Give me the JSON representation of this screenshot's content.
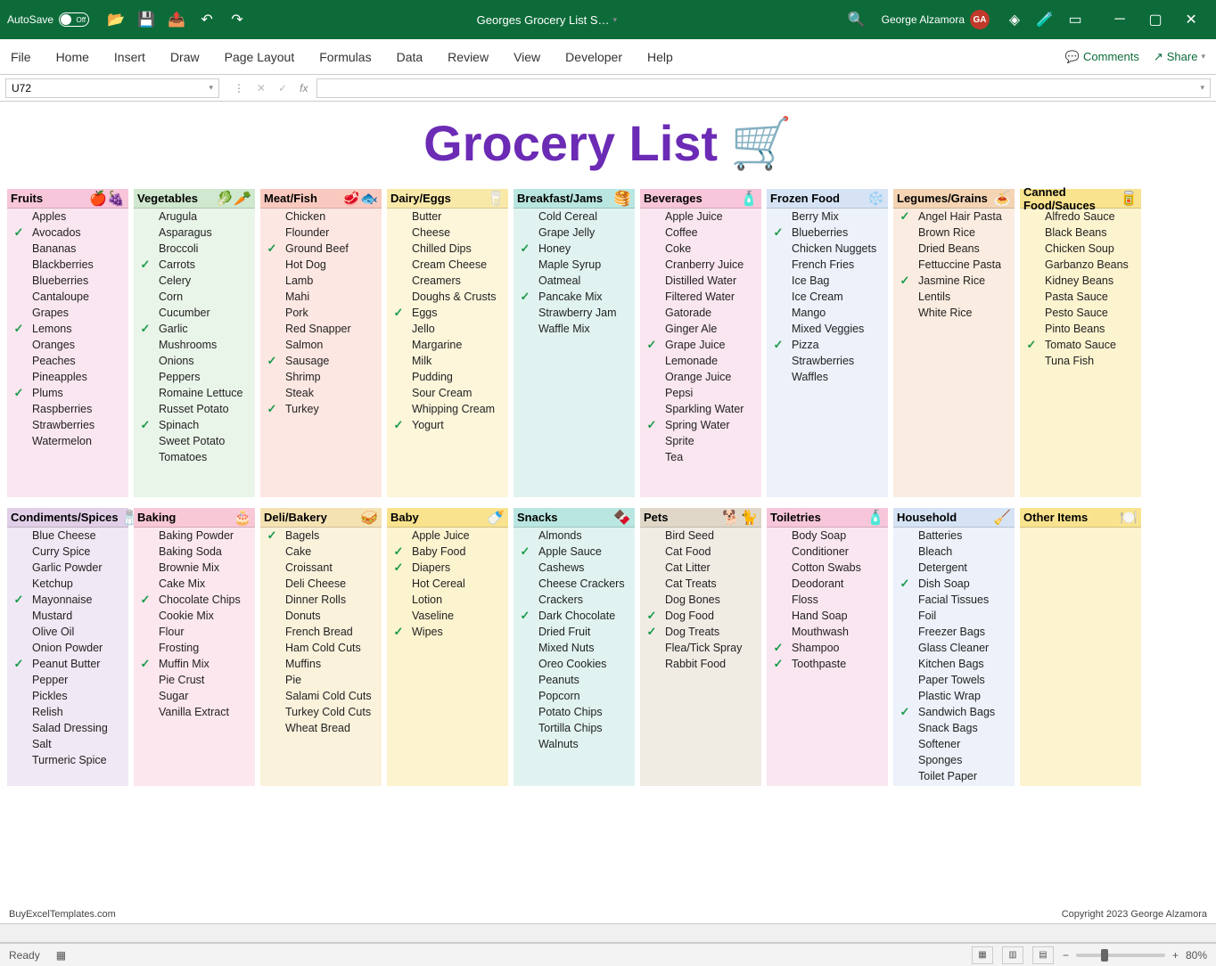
{
  "titlebar": {
    "autosave": "AutoSave",
    "autosave_state": "Off",
    "doc_title": "Georges Grocery List S…",
    "user_name": "George Alzamora",
    "user_initials": "GA"
  },
  "ribbon": {
    "tabs": [
      "File",
      "Home",
      "Insert",
      "Draw",
      "Page Layout",
      "Formulas",
      "Data",
      "Review",
      "View",
      "Developer",
      "Help"
    ],
    "comments": "Comments",
    "share": "Share"
  },
  "formula": {
    "cell": "U72",
    "fx": "fx"
  },
  "page": {
    "title": "Grocery List",
    "title_icon": "🛒",
    "footer_left": "BuyExcelTemplates.com",
    "footer_right": "Copyright 2023 George Alzamora"
  },
  "status": {
    "ready": "Ready",
    "zoom": "80%"
  },
  "categories_row1": [
    {
      "name": "Fruits",
      "icon": "🍎🍇",
      "head_bg": "#f7c6da",
      "body_bg": "#fae6f0",
      "items": [
        [
          "",
          "Apples"
        ],
        [
          "✓",
          "Avocados"
        ],
        [
          "",
          "Bananas"
        ],
        [
          "",
          "Blackberries"
        ],
        [
          "",
          "Blueberries"
        ],
        [
          "",
          "Cantaloupe"
        ],
        [
          "",
          "Grapes"
        ],
        [
          "✓",
          "Lemons"
        ],
        [
          "",
          "Oranges"
        ],
        [
          "",
          "Peaches"
        ],
        [
          "",
          "Pineapples"
        ],
        [
          "✓",
          "Plums"
        ],
        [
          "",
          "Raspberries"
        ],
        [
          "",
          "Strawberries"
        ],
        [
          "",
          "Watermelon"
        ],
        [
          "",
          ""
        ],
        [
          "",
          ""
        ],
        [
          "",
          ""
        ]
      ]
    },
    {
      "name": "Vegetables",
      "icon": "🥬🥕",
      "head_bg": "#cfe8cf",
      "body_bg": "#eaf5ea",
      "items": [
        [
          "",
          "Arugula"
        ],
        [
          "",
          "Asparagus"
        ],
        [
          "",
          "Broccoli"
        ],
        [
          "✓",
          "Carrots"
        ],
        [
          "",
          "Celery"
        ],
        [
          "",
          "Corn"
        ],
        [
          "",
          "Cucumber"
        ],
        [
          "✓",
          "Garlic"
        ],
        [
          "",
          "Mushrooms"
        ],
        [
          "",
          "Onions"
        ],
        [
          "",
          "Peppers"
        ],
        [
          "",
          "Romaine Lettuce"
        ],
        [
          "",
          "Russet Potato"
        ],
        [
          "✓",
          "Spinach"
        ],
        [
          "",
          "Sweet Potato"
        ],
        [
          "",
          "Tomatoes"
        ],
        [
          "",
          ""
        ],
        [
          "",
          ""
        ]
      ]
    },
    {
      "name": "Meat/Fish",
      "icon": "🥩🐟",
      "head_bg": "#f9c9bf",
      "body_bg": "#fde7e2",
      "items": [
        [
          "",
          "Chicken"
        ],
        [
          "",
          "Flounder"
        ],
        [
          "✓",
          "Ground Beef"
        ],
        [
          "",
          "Hot Dog"
        ],
        [
          "",
          "Lamb"
        ],
        [
          "",
          "Mahi"
        ],
        [
          "",
          "Pork"
        ],
        [
          "",
          "Red Snapper"
        ],
        [
          "",
          "Salmon"
        ],
        [
          "✓",
          "Sausage"
        ],
        [
          "",
          "Shrimp"
        ],
        [
          "",
          "Steak"
        ],
        [
          "✓",
          "Turkey"
        ],
        [
          "",
          ""
        ],
        [
          "",
          ""
        ],
        [
          "",
          ""
        ],
        [
          "",
          ""
        ],
        [
          "",
          ""
        ]
      ]
    },
    {
      "name": "Dairy/Eggs",
      "icon": "🥛",
      "head_bg": "#f9e9a9",
      "body_bg": "#fdf6db",
      "items": [
        [
          "",
          "Butter"
        ],
        [
          "",
          "Cheese"
        ],
        [
          "",
          "Chilled Dips"
        ],
        [
          "",
          "Cream Cheese"
        ],
        [
          "",
          "Creamers"
        ],
        [
          "",
          "Doughs & Crusts"
        ],
        [
          "✓",
          "Eggs"
        ],
        [
          "",
          "Jello"
        ],
        [
          "",
          "Margarine"
        ],
        [
          "",
          "Milk"
        ],
        [
          "",
          "Pudding"
        ],
        [
          "",
          "Sour Cream"
        ],
        [
          "",
          "Whipping Cream"
        ],
        [
          "✓",
          "Yogurt"
        ],
        [
          "",
          ""
        ],
        [
          "",
          ""
        ],
        [
          "",
          ""
        ],
        [
          "",
          ""
        ]
      ]
    },
    {
      "name": "Breakfast/Jams",
      "icon": "🥞",
      "head_bg": "#b9e6e0",
      "body_bg": "#e1f3f1",
      "items": [
        [
          "",
          "Cold Cereal"
        ],
        [
          "",
          "Grape Jelly"
        ],
        [
          "✓",
          "Honey"
        ],
        [
          "",
          "Maple Syrup"
        ],
        [
          "",
          "Oatmeal"
        ],
        [
          "✓",
          "Pancake Mix"
        ],
        [
          "",
          "Strawberry Jam"
        ],
        [
          "",
          "Waffle Mix"
        ],
        [
          "",
          ""
        ],
        [
          "",
          ""
        ],
        [
          "",
          ""
        ],
        [
          "",
          ""
        ],
        [
          "",
          ""
        ],
        [
          "",
          ""
        ],
        [
          "",
          ""
        ],
        [
          "",
          ""
        ],
        [
          "",
          ""
        ],
        [
          "",
          ""
        ]
      ]
    },
    {
      "name": "Beverages",
      "icon": "🧴",
      "head_bg": "#f7c6da",
      "body_bg": "#fae6f0",
      "items": [
        [
          "",
          "Apple Juice"
        ],
        [
          "",
          "Coffee"
        ],
        [
          "",
          "Coke"
        ],
        [
          "",
          "Cranberry Juice"
        ],
        [
          "",
          "Distilled Water"
        ],
        [
          "",
          "Filtered Water"
        ],
        [
          "",
          "Gatorade"
        ],
        [
          "",
          "Ginger Ale"
        ],
        [
          "✓",
          "Grape Juice"
        ],
        [
          "",
          "Lemonade"
        ],
        [
          "",
          "Orange Juice"
        ],
        [
          "",
          "Pepsi"
        ],
        [
          "",
          "Sparkling Water"
        ],
        [
          "✓",
          "Spring Water"
        ],
        [
          "",
          "Sprite"
        ],
        [
          "",
          "Tea"
        ],
        [
          "",
          ""
        ],
        [
          "",
          ""
        ]
      ]
    },
    {
      "name": "Frozen Food",
      "icon": "❄️",
      "head_bg": "#d6e3f5",
      "body_bg": "#ecf1fa",
      "items": [
        [
          "",
          "Berry Mix"
        ],
        [
          "✓",
          "Blueberries"
        ],
        [
          "",
          "Chicken Nuggets"
        ],
        [
          "",
          "French Fries"
        ],
        [
          "",
          "Ice Bag"
        ],
        [
          "",
          "Ice Cream"
        ],
        [
          "",
          "Mango"
        ],
        [
          "",
          "Mixed Veggies"
        ],
        [
          "✓",
          "Pizza"
        ],
        [
          "",
          "Strawberries"
        ],
        [
          "",
          "Waffles"
        ],
        [
          "",
          ""
        ],
        [
          "",
          ""
        ],
        [
          "",
          ""
        ],
        [
          "",
          ""
        ],
        [
          "",
          ""
        ],
        [
          "",
          ""
        ],
        [
          "",
          ""
        ]
      ]
    },
    {
      "name": "Legumes/Grains",
      "icon": "🍝",
      "head_bg": "#f4d4b3",
      "body_bg": "#faece0",
      "items": [
        [
          "✓",
          "Angel Hair Pasta"
        ],
        [
          "",
          "Brown Rice"
        ],
        [
          "",
          "Dried Beans"
        ],
        [
          "",
          "Fettuccine Pasta"
        ],
        [
          "✓",
          "Jasmine Rice"
        ],
        [
          "",
          "Lentils"
        ],
        [
          "",
          "White Rice"
        ],
        [
          "",
          ""
        ],
        [
          "",
          ""
        ],
        [
          "",
          ""
        ],
        [
          "",
          ""
        ],
        [
          "",
          ""
        ],
        [
          "",
          ""
        ],
        [
          "",
          ""
        ],
        [
          "",
          ""
        ],
        [
          "",
          ""
        ],
        [
          "",
          ""
        ],
        [
          "",
          ""
        ]
      ]
    },
    {
      "name": "Canned Food/Sauces",
      "icon": "🥫",
      "head_bg": "#f9e38f",
      "body_bg": "#fcf3cf",
      "items": [
        [
          "",
          "Alfredo Sauce"
        ],
        [
          "",
          "Black Beans"
        ],
        [
          "",
          "Chicken Soup"
        ],
        [
          "",
          "Garbanzo Beans"
        ],
        [
          "",
          "Kidney Beans"
        ],
        [
          "",
          "Pasta Sauce"
        ],
        [
          "",
          "Pesto Sauce"
        ],
        [
          "",
          "Pinto Beans"
        ],
        [
          "✓",
          "Tomato Sauce"
        ],
        [
          "",
          "Tuna Fish"
        ],
        [
          "",
          ""
        ],
        [
          "",
          ""
        ],
        [
          "",
          ""
        ],
        [
          "",
          ""
        ],
        [
          "",
          ""
        ],
        [
          "",
          ""
        ],
        [
          "",
          ""
        ],
        [
          "",
          ""
        ]
      ]
    }
  ],
  "categories_row2": [
    {
      "name": "Condiments/Spices",
      "icon": "🧂",
      "head_bg": "#e1cfe8",
      "body_bg": "#f0e8f4",
      "items": [
        [
          "",
          "Blue Cheese"
        ],
        [
          "",
          "Curry Spice"
        ],
        [
          "",
          "Garlic Powder"
        ],
        [
          "",
          "Ketchup"
        ],
        [
          "✓",
          "Mayonnaise"
        ],
        [
          "",
          "Mustard"
        ],
        [
          "",
          "Olive Oil"
        ],
        [
          "",
          "Onion Powder"
        ],
        [
          "✓",
          "Peanut Butter"
        ],
        [
          "",
          "Pepper"
        ],
        [
          "",
          "Pickles"
        ],
        [
          "",
          "Relish"
        ],
        [
          "",
          "Salad Dressing"
        ],
        [
          "",
          "Salt"
        ],
        [
          "",
          "Turmeric Spice"
        ],
        [
          "",
          ""
        ]
      ]
    },
    {
      "name": "Baking",
      "icon": "🎂",
      "head_bg": "#f9c8d6",
      "body_bg": "#fce7ee",
      "items": [
        [
          "",
          "Baking Powder"
        ],
        [
          "",
          "Baking Soda"
        ],
        [
          "",
          "Brownie Mix"
        ],
        [
          "",
          "Cake Mix"
        ],
        [
          "✓",
          "Chocolate Chips"
        ],
        [
          "",
          "Cookie Mix"
        ],
        [
          "",
          "Flour"
        ],
        [
          "",
          "Frosting"
        ],
        [
          "✓",
          "Muffin Mix"
        ],
        [
          "",
          "Pie Crust"
        ],
        [
          "",
          "Sugar"
        ],
        [
          "",
          "Vanilla Extract"
        ],
        [
          "",
          ""
        ],
        [
          "",
          ""
        ],
        [
          "",
          ""
        ],
        [
          "",
          ""
        ]
      ]
    },
    {
      "name": "Deli/Bakery",
      "icon": "🥪",
      "head_bg": "#f5e2b3",
      "body_bg": "#fbf2dc",
      "items": [
        [
          "✓",
          "Bagels"
        ],
        [
          "",
          "Cake"
        ],
        [
          "",
          "Croissant"
        ],
        [
          "",
          "Deli Cheese"
        ],
        [
          "",
          "Dinner Rolls"
        ],
        [
          "",
          "Donuts"
        ],
        [
          "",
          "French Bread"
        ],
        [
          "",
          "Ham Cold Cuts"
        ],
        [
          "",
          "Muffins"
        ],
        [
          "",
          "Pie"
        ],
        [
          "",
          "Salami Cold Cuts"
        ],
        [
          "",
          "Turkey Cold Cuts"
        ],
        [
          "",
          "Wheat Bread"
        ],
        [
          "",
          ""
        ],
        [
          "",
          ""
        ],
        [
          "",
          ""
        ]
      ]
    },
    {
      "name": "Baby",
      "icon": "🍼",
      "head_bg": "#f9e38f",
      "body_bg": "#fcf3cf",
      "items": [
        [
          "",
          "Apple Juice"
        ],
        [
          "✓",
          "Baby Food"
        ],
        [
          "✓",
          "Diapers"
        ],
        [
          "",
          "Hot Cereal"
        ],
        [
          "",
          "Lotion"
        ],
        [
          "",
          "Vaseline"
        ],
        [
          "✓",
          "Wipes"
        ],
        [
          "",
          ""
        ],
        [
          "",
          ""
        ],
        [
          "",
          ""
        ],
        [
          "",
          ""
        ],
        [
          "",
          ""
        ],
        [
          "",
          ""
        ],
        [
          "",
          ""
        ],
        [
          "",
          ""
        ],
        [
          "",
          ""
        ]
      ]
    },
    {
      "name": "Snacks",
      "icon": "🍫",
      "head_bg": "#b9e6e0",
      "body_bg": "#e1f3f1",
      "items": [
        [
          "",
          "Almonds"
        ],
        [
          "✓",
          "Apple Sauce"
        ],
        [
          "",
          "Cashews"
        ],
        [
          "",
          "Cheese Crackers"
        ],
        [
          "",
          "Crackers"
        ],
        [
          "✓",
          "Dark Chocolate"
        ],
        [
          "",
          "Dried Fruit"
        ],
        [
          "",
          "Mixed Nuts"
        ],
        [
          "",
          "Oreo Cookies"
        ],
        [
          "",
          "Peanuts"
        ],
        [
          "",
          "Popcorn"
        ],
        [
          "",
          "Potato Chips"
        ],
        [
          "",
          "Tortilla Chips"
        ],
        [
          "",
          "Walnuts"
        ],
        [
          "",
          ""
        ],
        [
          "",
          ""
        ]
      ]
    },
    {
      "name": "Pets",
      "icon": "🐕🐈",
      "head_bg": "#e0d7c8",
      "body_bg": "#f0ece4",
      "items": [
        [
          "",
          "Bird Seed"
        ],
        [
          "",
          "Cat Food"
        ],
        [
          "",
          "Cat Litter"
        ],
        [
          "",
          "Cat Treats"
        ],
        [
          "",
          "Dog Bones"
        ],
        [
          "✓",
          "Dog Food"
        ],
        [
          "✓",
          "Dog Treats"
        ],
        [
          "",
          "Flea/Tick Spray"
        ],
        [
          "",
          "Rabbit Food"
        ],
        [
          "",
          ""
        ],
        [
          "",
          ""
        ],
        [
          "",
          ""
        ],
        [
          "",
          ""
        ],
        [
          "",
          ""
        ],
        [
          "",
          ""
        ],
        [
          "",
          ""
        ]
      ]
    },
    {
      "name": "Toiletries",
      "icon": "🧴",
      "head_bg": "#f7c6da",
      "body_bg": "#fae6f0",
      "items": [
        [
          "",
          "Body Soap"
        ],
        [
          "",
          "Conditioner"
        ],
        [
          "",
          "Cotton Swabs"
        ],
        [
          "",
          "Deodorant"
        ],
        [
          "",
          "Floss"
        ],
        [
          "",
          "Hand Soap"
        ],
        [
          "",
          "Mouthwash"
        ],
        [
          "✓",
          "Shampoo"
        ],
        [
          "✓",
          "Toothpaste"
        ],
        [
          "",
          ""
        ],
        [
          "",
          ""
        ],
        [
          "",
          ""
        ],
        [
          "",
          ""
        ],
        [
          "",
          ""
        ],
        [
          "",
          ""
        ],
        [
          "",
          ""
        ]
      ]
    },
    {
      "name": "Household",
      "icon": "🧹",
      "head_bg": "#d6e3f5",
      "body_bg": "#ecf1fa",
      "items": [
        [
          "",
          "Batteries"
        ],
        [
          "",
          "Bleach"
        ],
        [
          "",
          "Detergent"
        ],
        [
          "✓",
          "Dish Soap"
        ],
        [
          "",
          "Facial Tissues"
        ],
        [
          "",
          "Foil"
        ],
        [
          "",
          "Freezer Bags"
        ],
        [
          "",
          "Glass Cleaner"
        ],
        [
          "",
          "Kitchen Bags"
        ],
        [
          "",
          "Paper Towels"
        ],
        [
          "",
          "Plastic Wrap"
        ],
        [
          "✓",
          "Sandwich Bags"
        ],
        [
          "",
          "Snack Bags"
        ],
        [
          "",
          "Softener"
        ],
        [
          "",
          "Sponges"
        ],
        [
          "",
          "Toilet Paper"
        ]
      ]
    },
    {
      "name": "Other Items",
      "icon": "🍽️",
      "head_bg": "#f9e38f",
      "body_bg": "#fcf3cf",
      "items": [
        [
          "",
          ""
        ],
        [
          "",
          ""
        ],
        [
          "",
          ""
        ],
        [
          "",
          ""
        ],
        [
          "",
          ""
        ],
        [
          "",
          ""
        ],
        [
          "",
          ""
        ],
        [
          "",
          ""
        ],
        [
          "",
          ""
        ],
        [
          "",
          ""
        ],
        [
          "",
          ""
        ],
        [
          "",
          ""
        ],
        [
          "",
          ""
        ],
        [
          "",
          ""
        ],
        [
          "",
          ""
        ],
        [
          "",
          ""
        ]
      ]
    }
  ]
}
